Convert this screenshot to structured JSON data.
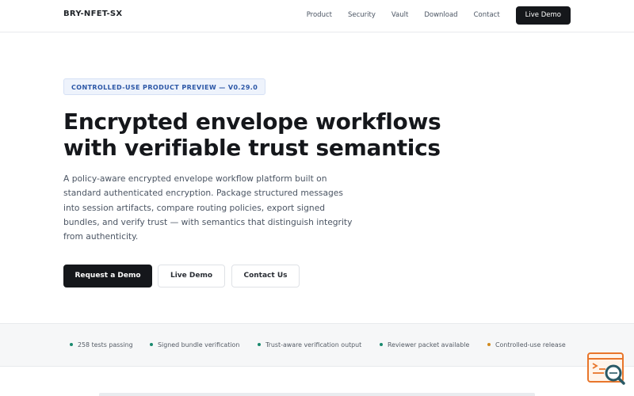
{
  "nav": {
    "brand": "BRY-NFET-SX",
    "links": [
      "Product",
      "Security",
      "Vault",
      "Download",
      "Contact"
    ],
    "cta": "Live Demo"
  },
  "hero": {
    "badge": "CONTROLLED-USE PRODUCT PREVIEW — V0.29.0",
    "title_line1": "Encrypted envelope workflows",
    "title_line2": "with verifiable trust semantics",
    "subtitle": "A policy-aware encrypted envelope workflow platform built on standard authenticated encryption. Package structured messages into session artifacts, compare routing policies, export signed bundles, and verify trust — with semantics that distinguish integrity from authenticity.",
    "buttons": {
      "primary": "Request a Demo",
      "demo": "Live Demo",
      "contact": "Contact Us"
    }
  },
  "status": {
    "items": [
      {
        "label": "258 tests passing",
        "color": "#1a8a6e"
      },
      {
        "label": "Signed bundle verification",
        "color": "#1a8a6e"
      },
      {
        "label": "Trust-aware verification output",
        "color": "#1a8a6e"
      },
      {
        "label": "Reviewer packet available",
        "color": "#1a8a6e"
      },
      {
        "label": "Controlled-use release",
        "color": "#d18b1f"
      }
    ]
  },
  "widget": {
    "icon": "terminal-search-icon",
    "colors": {
      "accent": "#e8762b",
      "lens": "#2a5a66"
    }
  }
}
